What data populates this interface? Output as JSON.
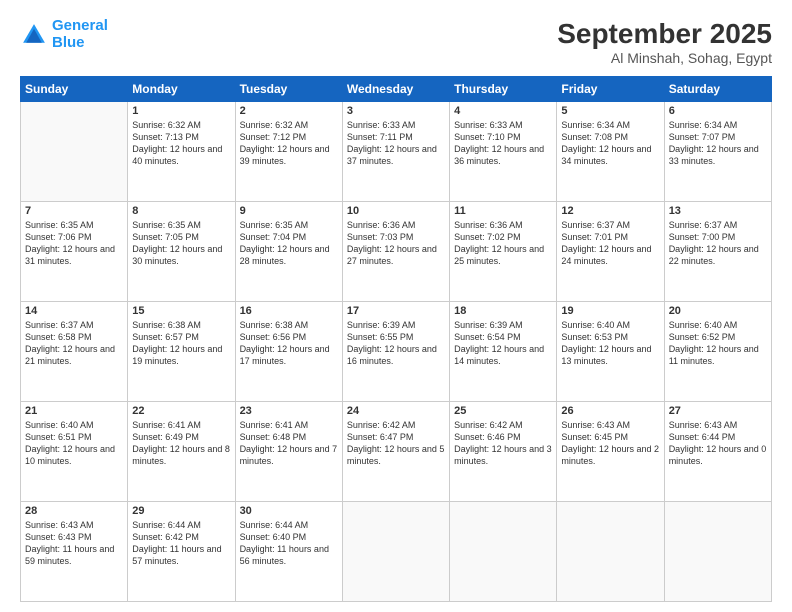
{
  "logo": {
    "line1": "General",
    "line2": "Blue"
  },
  "header": {
    "month": "September 2025",
    "location": "Al Minshah, Sohag, Egypt"
  },
  "weekdays": [
    "Sunday",
    "Monday",
    "Tuesday",
    "Wednesday",
    "Thursday",
    "Friday",
    "Saturday"
  ],
  "weeks": [
    [
      {
        "day": "",
        "empty": true
      },
      {
        "day": "1",
        "sunrise": "Sunrise: 6:32 AM",
        "sunset": "Sunset: 7:13 PM",
        "daylight": "Daylight: 12 hours and 40 minutes."
      },
      {
        "day": "2",
        "sunrise": "Sunrise: 6:32 AM",
        "sunset": "Sunset: 7:12 PM",
        "daylight": "Daylight: 12 hours and 39 minutes."
      },
      {
        "day": "3",
        "sunrise": "Sunrise: 6:33 AM",
        "sunset": "Sunset: 7:11 PM",
        "daylight": "Daylight: 12 hours and 37 minutes."
      },
      {
        "day": "4",
        "sunrise": "Sunrise: 6:33 AM",
        "sunset": "Sunset: 7:10 PM",
        "daylight": "Daylight: 12 hours and 36 minutes."
      },
      {
        "day": "5",
        "sunrise": "Sunrise: 6:34 AM",
        "sunset": "Sunset: 7:08 PM",
        "daylight": "Daylight: 12 hours and 34 minutes."
      },
      {
        "day": "6",
        "sunrise": "Sunrise: 6:34 AM",
        "sunset": "Sunset: 7:07 PM",
        "daylight": "Daylight: 12 hours and 33 minutes."
      }
    ],
    [
      {
        "day": "7",
        "sunrise": "Sunrise: 6:35 AM",
        "sunset": "Sunset: 7:06 PM",
        "daylight": "Daylight: 12 hours and 31 minutes."
      },
      {
        "day": "8",
        "sunrise": "Sunrise: 6:35 AM",
        "sunset": "Sunset: 7:05 PM",
        "daylight": "Daylight: 12 hours and 30 minutes."
      },
      {
        "day": "9",
        "sunrise": "Sunrise: 6:35 AM",
        "sunset": "Sunset: 7:04 PM",
        "daylight": "Daylight: 12 hours and 28 minutes."
      },
      {
        "day": "10",
        "sunrise": "Sunrise: 6:36 AM",
        "sunset": "Sunset: 7:03 PM",
        "daylight": "Daylight: 12 hours and 27 minutes."
      },
      {
        "day": "11",
        "sunrise": "Sunrise: 6:36 AM",
        "sunset": "Sunset: 7:02 PM",
        "daylight": "Daylight: 12 hours and 25 minutes."
      },
      {
        "day": "12",
        "sunrise": "Sunrise: 6:37 AM",
        "sunset": "Sunset: 7:01 PM",
        "daylight": "Daylight: 12 hours and 24 minutes."
      },
      {
        "day": "13",
        "sunrise": "Sunrise: 6:37 AM",
        "sunset": "Sunset: 7:00 PM",
        "daylight": "Daylight: 12 hours and 22 minutes."
      }
    ],
    [
      {
        "day": "14",
        "sunrise": "Sunrise: 6:37 AM",
        "sunset": "Sunset: 6:58 PM",
        "daylight": "Daylight: 12 hours and 21 minutes."
      },
      {
        "day": "15",
        "sunrise": "Sunrise: 6:38 AM",
        "sunset": "Sunset: 6:57 PM",
        "daylight": "Daylight: 12 hours and 19 minutes."
      },
      {
        "day": "16",
        "sunrise": "Sunrise: 6:38 AM",
        "sunset": "Sunset: 6:56 PM",
        "daylight": "Daylight: 12 hours and 17 minutes."
      },
      {
        "day": "17",
        "sunrise": "Sunrise: 6:39 AM",
        "sunset": "Sunset: 6:55 PM",
        "daylight": "Daylight: 12 hours and 16 minutes."
      },
      {
        "day": "18",
        "sunrise": "Sunrise: 6:39 AM",
        "sunset": "Sunset: 6:54 PM",
        "daylight": "Daylight: 12 hours and 14 minutes."
      },
      {
        "day": "19",
        "sunrise": "Sunrise: 6:40 AM",
        "sunset": "Sunset: 6:53 PM",
        "daylight": "Daylight: 12 hours and 13 minutes."
      },
      {
        "day": "20",
        "sunrise": "Sunrise: 6:40 AM",
        "sunset": "Sunset: 6:52 PM",
        "daylight": "Daylight: 12 hours and 11 minutes."
      }
    ],
    [
      {
        "day": "21",
        "sunrise": "Sunrise: 6:40 AM",
        "sunset": "Sunset: 6:51 PM",
        "daylight": "Daylight: 12 hours and 10 minutes."
      },
      {
        "day": "22",
        "sunrise": "Sunrise: 6:41 AM",
        "sunset": "Sunset: 6:49 PM",
        "daylight": "Daylight: 12 hours and 8 minutes."
      },
      {
        "day": "23",
        "sunrise": "Sunrise: 6:41 AM",
        "sunset": "Sunset: 6:48 PM",
        "daylight": "Daylight: 12 hours and 7 minutes."
      },
      {
        "day": "24",
        "sunrise": "Sunrise: 6:42 AM",
        "sunset": "Sunset: 6:47 PM",
        "daylight": "Daylight: 12 hours and 5 minutes."
      },
      {
        "day": "25",
        "sunrise": "Sunrise: 6:42 AM",
        "sunset": "Sunset: 6:46 PM",
        "daylight": "Daylight: 12 hours and 3 minutes."
      },
      {
        "day": "26",
        "sunrise": "Sunrise: 6:43 AM",
        "sunset": "Sunset: 6:45 PM",
        "daylight": "Daylight: 12 hours and 2 minutes."
      },
      {
        "day": "27",
        "sunrise": "Sunrise: 6:43 AM",
        "sunset": "Sunset: 6:44 PM",
        "daylight": "Daylight: 12 hours and 0 minutes."
      }
    ],
    [
      {
        "day": "28",
        "sunrise": "Sunrise: 6:43 AM",
        "sunset": "Sunset: 6:43 PM",
        "daylight": "Daylight: 11 hours and 59 minutes."
      },
      {
        "day": "29",
        "sunrise": "Sunrise: 6:44 AM",
        "sunset": "Sunset: 6:42 PM",
        "daylight": "Daylight: 11 hours and 57 minutes."
      },
      {
        "day": "30",
        "sunrise": "Sunrise: 6:44 AM",
        "sunset": "Sunset: 6:40 PM",
        "daylight": "Daylight: 11 hours and 56 minutes."
      },
      {
        "day": "",
        "empty": true
      },
      {
        "day": "",
        "empty": true
      },
      {
        "day": "",
        "empty": true
      },
      {
        "day": "",
        "empty": true
      }
    ]
  ]
}
